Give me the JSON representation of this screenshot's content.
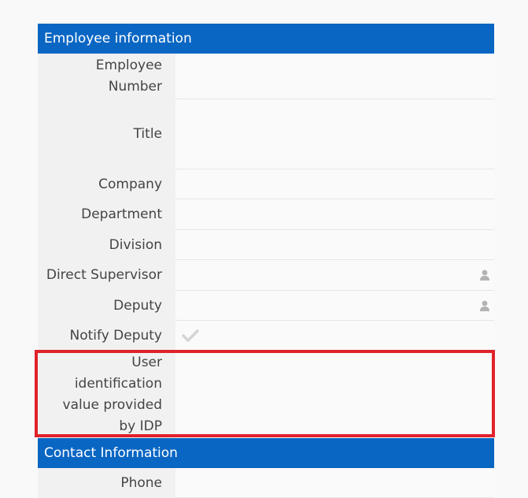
{
  "sections": {
    "employee": {
      "title": "Employee information",
      "fields": [
        {
          "label": "Employee Number",
          "value": ""
        },
        {
          "label": "Title",
          "value": ""
        },
        {
          "label": "Company",
          "value": ""
        },
        {
          "label": "Department",
          "value": ""
        },
        {
          "label": "Division",
          "value": ""
        },
        {
          "label": "Direct Supervisor",
          "value": "",
          "icon": "person-icon"
        },
        {
          "label": "Deputy",
          "value": "",
          "icon": "person-icon"
        },
        {
          "label": "Notify Deputy",
          "value": "",
          "icon": "checkmark-icon"
        },
        {
          "label": "User identification value provided by IDP",
          "value": ""
        }
      ]
    },
    "contact": {
      "title": "Contact Information",
      "fields": [
        {
          "label": "Phone",
          "value": ""
        }
      ]
    }
  },
  "colors": {
    "header_bg": "#0966c3",
    "highlight": "#e0222b",
    "icon": "#b3b3b3"
  }
}
